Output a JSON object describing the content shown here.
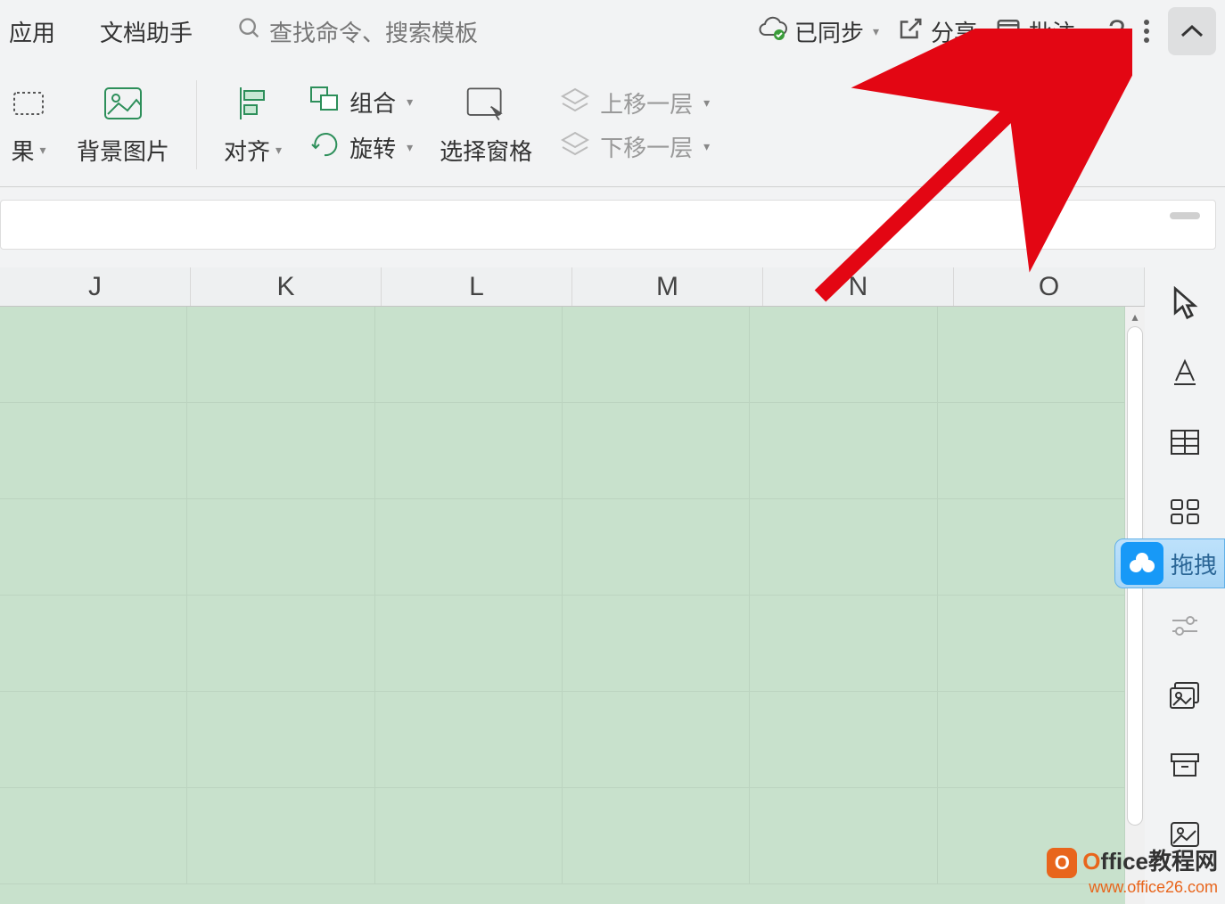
{
  "topbar": {
    "app_use": "应用",
    "doc_assistant": "文档助手",
    "search_placeholder": "查找命令、搜索模板",
    "synced": "已同步",
    "share": "分享",
    "comments": "批注"
  },
  "ribbon": {
    "effect": "果",
    "bg_image": "背景图片",
    "align": "对齐",
    "group": "组合",
    "rotate": "旋转",
    "select_pane": "选择窗格",
    "move_up": "上移一层",
    "move_down": "下移一层"
  },
  "columns": [
    "J",
    "K",
    "L",
    "M",
    "N",
    "O"
  ],
  "drag_tab": "拖拽",
  "watermark": {
    "title_prefix": "O",
    "title_rest": "ffice教程网",
    "url": "www.office26.com"
  },
  "icons": {
    "cloud": "cloud-synced-icon",
    "share": "share-icon",
    "comment": "comment-icon",
    "help": "help-icon",
    "more": "more-icon",
    "collapse": "chevron-up-icon"
  }
}
